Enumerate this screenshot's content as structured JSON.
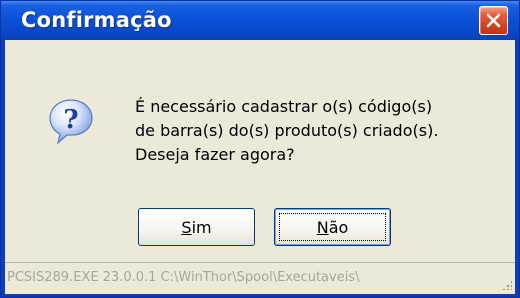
{
  "window": {
    "title": "Confirmação"
  },
  "dialog": {
    "icon": "question-icon",
    "message_lines": [
      "É necessário cadastrar o(s) código(s)",
      "de barra(s) do(s) produto(s) criado(s).",
      "Deseja fazer agora?"
    ],
    "buttons": {
      "yes_label": "Sim",
      "no_label": "Não"
    }
  },
  "statusbar": {
    "text": "PCSIS289.EXE 23.0.0.1 C:\\WinThor\\Spool\\Executaveis\\"
  },
  "colors": {
    "titlebar": "#0a52d8",
    "client_bg": "#ece9d8",
    "close_button": "#d3431f",
    "button_border": "#003c74"
  }
}
